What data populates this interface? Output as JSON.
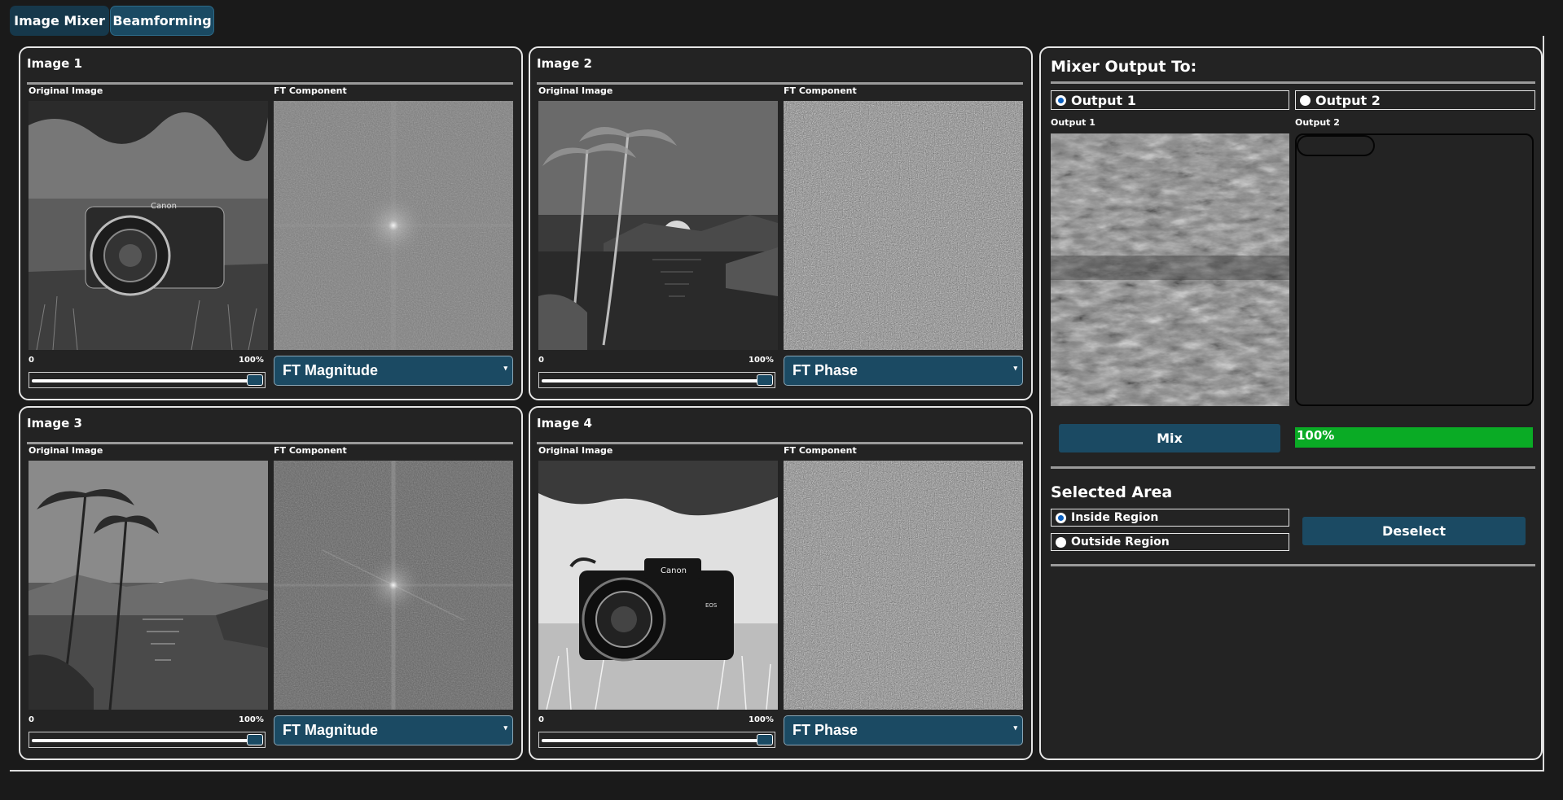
{
  "tabs": [
    {
      "label": "Image Mixer"
    },
    {
      "label": "Beamforming"
    }
  ],
  "images": [
    {
      "title": "Image 1",
      "original_label": "Original Image",
      "ft_label": "FT Component",
      "slider_min": "0",
      "slider_max": "100%",
      "slider_value": 100,
      "component": "FT Magnitude"
    },
    {
      "title": "Image 2",
      "original_label": "Original Image",
      "ft_label": "FT Component",
      "slider_min": "0",
      "slider_max": "100%",
      "slider_value": 100,
      "component": "FT Phase"
    },
    {
      "title": "Image 3",
      "original_label": "Original Image",
      "ft_label": "FT Component",
      "slider_min": "0",
      "slider_max": "100%",
      "slider_value": 100,
      "component": "FT Magnitude"
    },
    {
      "title": "Image 4",
      "original_label": "Original Image",
      "ft_label": "FT Component",
      "slider_min": "0",
      "slider_max": "100%",
      "slider_value": 100,
      "component": "FT Phase"
    }
  ],
  "mixer": {
    "title": "Mixer Output To:",
    "output_options": [
      {
        "label": "Output 1",
        "selected": true
      },
      {
        "label": "Output 2",
        "selected": false
      }
    ],
    "output1_label": "Output 1",
    "output2_label": "Output 2",
    "mix_button": "Mix",
    "progress_text": "100%",
    "progress_value": 100,
    "progress_color": "#0aab25",
    "selected_area_title": "Selected Area",
    "region_options": [
      {
        "label": "Inside Region",
        "selected": true
      },
      {
        "label": "Outside Region",
        "selected": false
      }
    ],
    "deselect_button": "Deselect"
  },
  "colors": {
    "accent": "#1b4a63",
    "background": "#1a1a1a",
    "panel": "#232323"
  }
}
